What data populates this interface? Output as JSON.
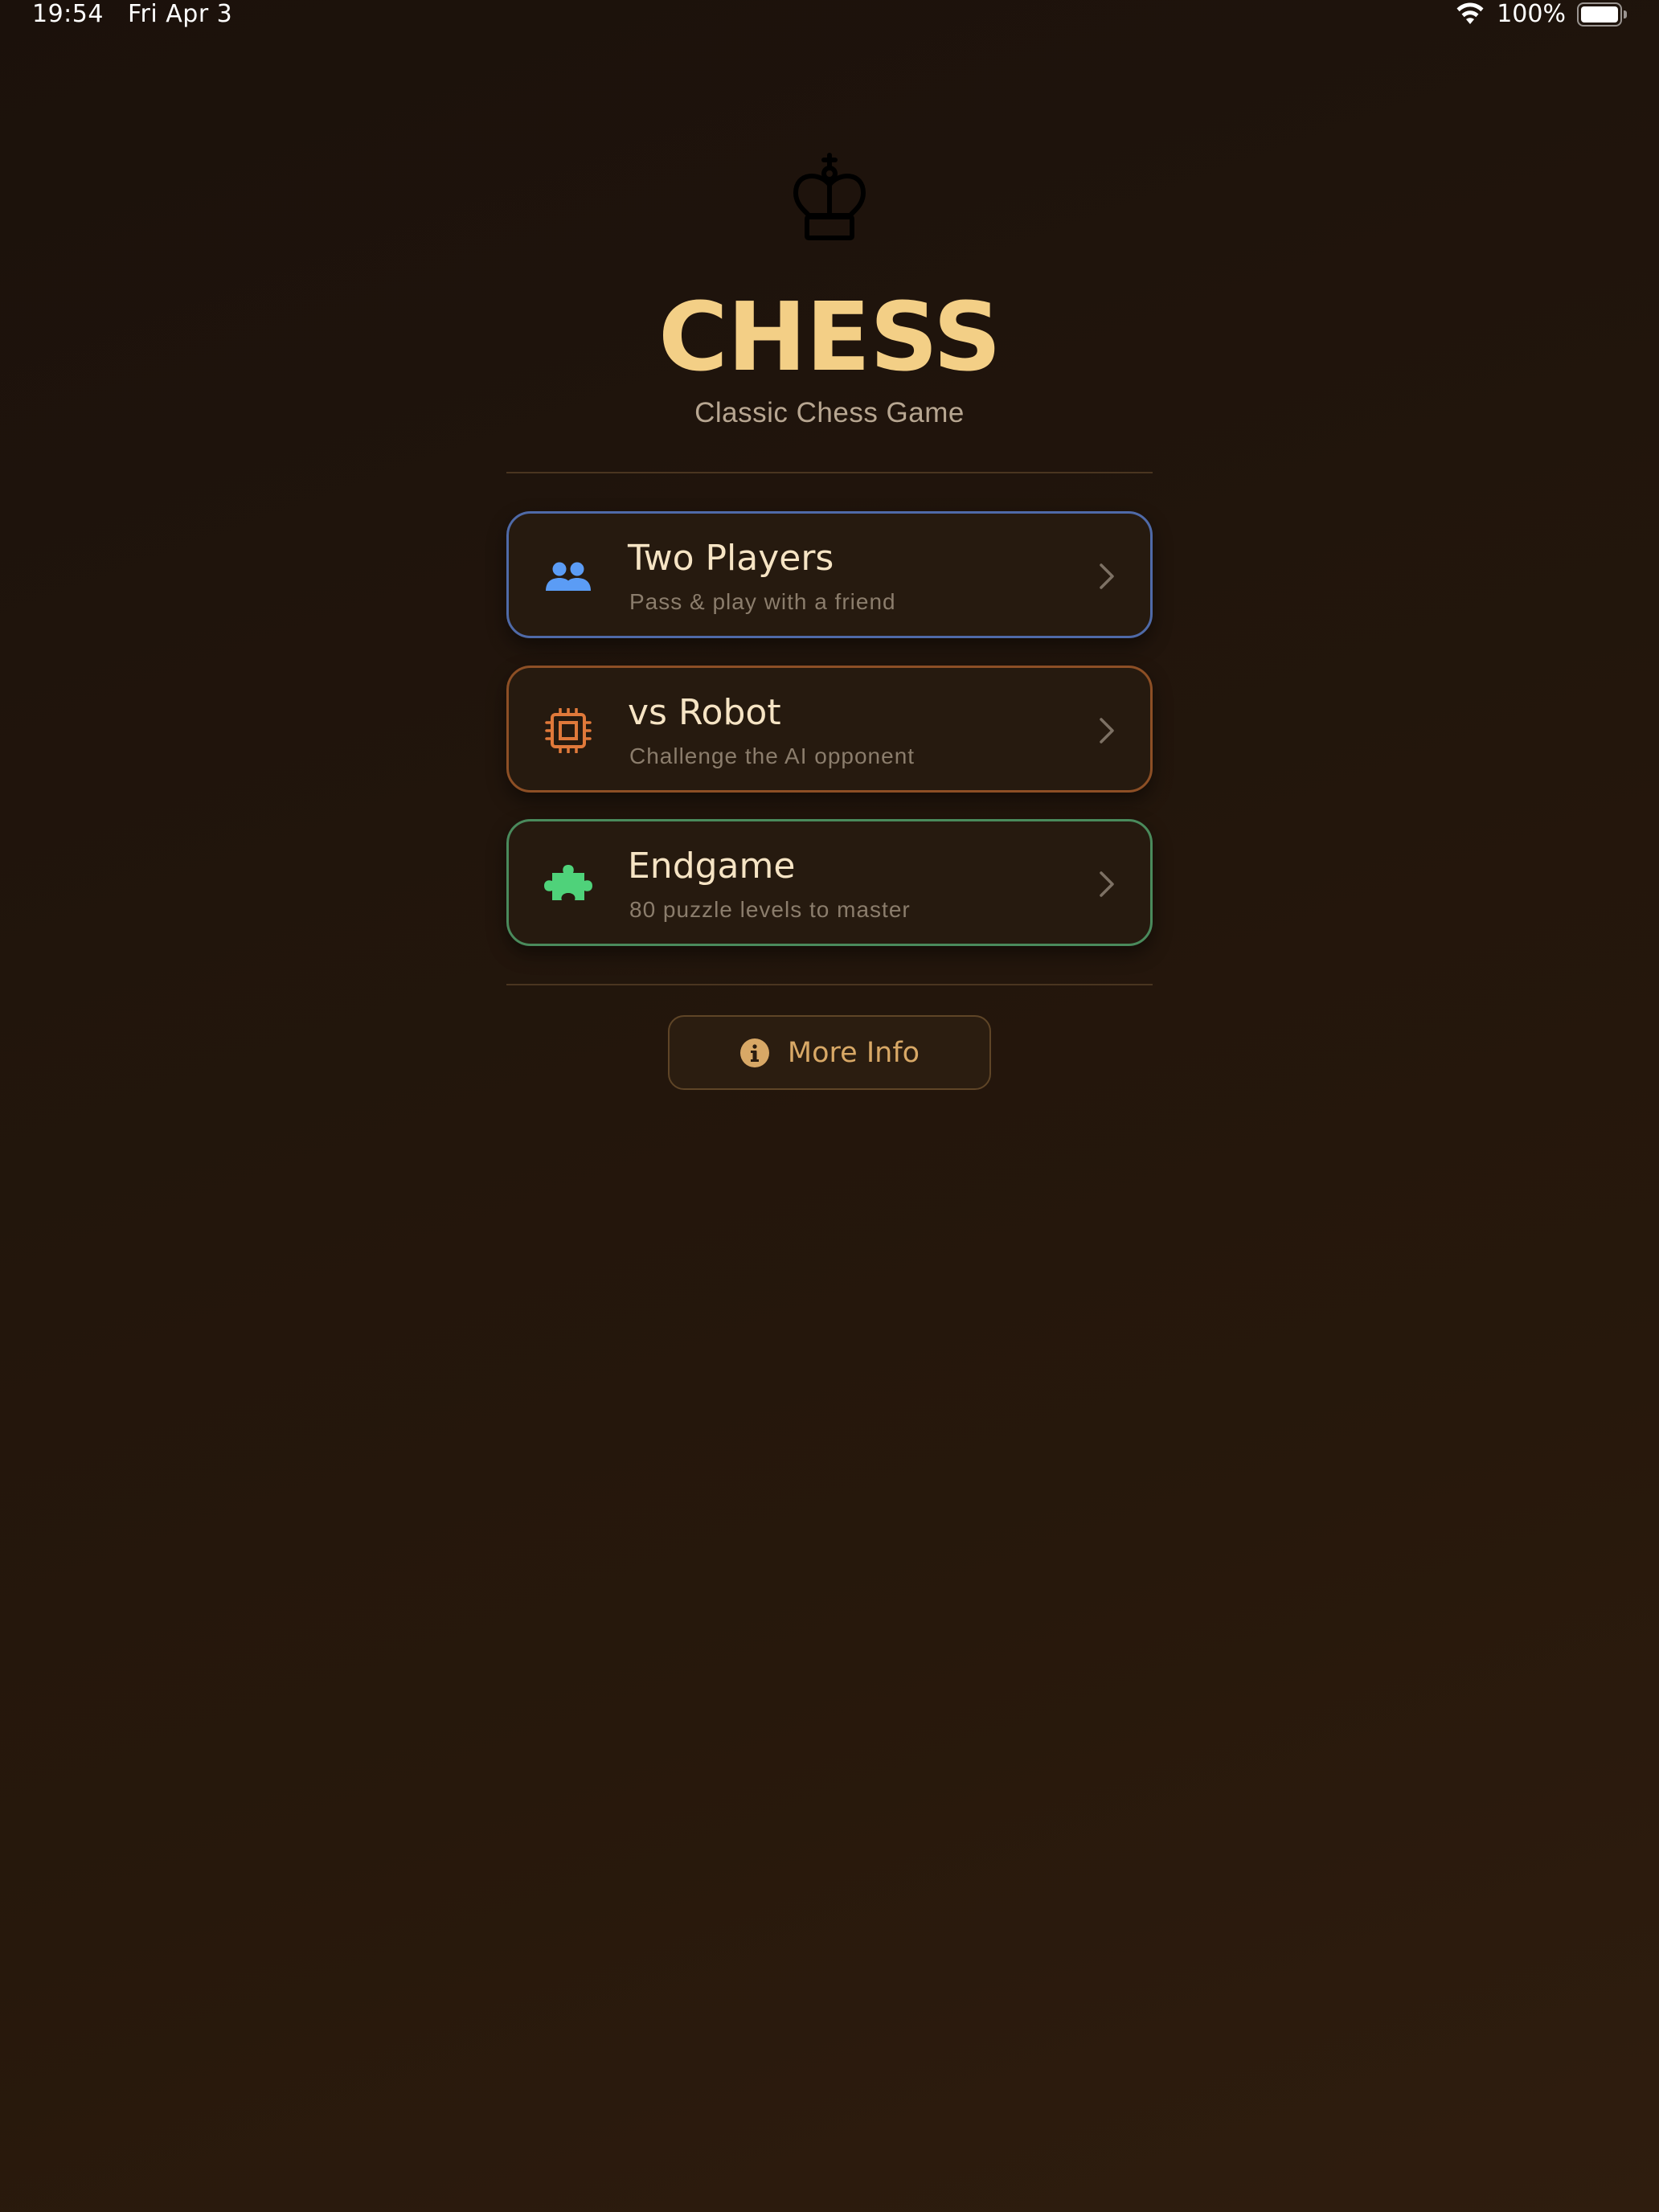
{
  "status_bar": {
    "time": "19:54",
    "date": "Fri Apr 3",
    "battery_text": "100%",
    "wifi_icon": "wifi-icon",
    "battery_icon": "battery-icon"
  },
  "header": {
    "icon": "chess-king-icon",
    "title": "CHESS",
    "subtitle": "Classic Chess Game"
  },
  "modes": [
    {
      "title": "Two Players",
      "subtitle": "Pass & play with a friend",
      "icon": "two-people-icon",
      "accent": "#5b9cf5"
    },
    {
      "title": "vs Robot",
      "subtitle": "Challenge the AI opponent",
      "icon": "cpu-chip-icon",
      "accent": "#e0793a"
    },
    {
      "title": "Endgame",
      "subtitle": "80 puzzle levels to master",
      "icon": "puzzle-piece-icon",
      "accent": "#4fd27a"
    }
  ],
  "more_info": {
    "label": "More Info",
    "icon": "info-circle-icon"
  },
  "colors": {
    "title": "#f3cf86",
    "background": "#1f140b"
  }
}
